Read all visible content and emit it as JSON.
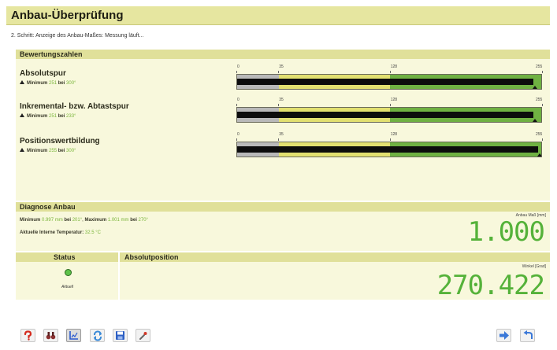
{
  "window": {
    "title": "Anbau-Überprüfung"
  },
  "step": {
    "text": "2. Schritt: Anzeige des Anbau-Maßes: Messung läuft..."
  },
  "ratings": {
    "header": "Bewertungszahlen",
    "scale_ticks": [
      "0",
      "35",
      "128",
      "255"
    ],
    "rows": [
      {
        "name": "Absolutspur",
        "min_label": "Minimum",
        "min_value": "251",
        "at_label": "bei",
        "at_value": "300°",
        "value": 251
      },
      {
        "name": "Inkremental- bzw. Abtastspur",
        "min_label": "Minimum",
        "min_value": "251",
        "at_label": "bei",
        "at_value": "233°",
        "value": 251
      },
      {
        "name": "Positionswertbildung",
        "min_label": "Minimum",
        "min_value": "255",
        "at_label": "bei",
        "at_value": "300°",
        "value": 255
      }
    ]
  },
  "diagnose": {
    "header": "Diagnose Anbau",
    "line1": {
      "min_label": "Minimum",
      "min_value": "0.997 mm",
      "min_at": "bei",
      "min_deg": "201°",
      "sep": ",",
      "max_label": "Maximum",
      "max_value": "1.001 mm",
      "max_at": "bei",
      "max_deg": "270°"
    },
    "line2": {
      "label": "Aktuelle Interne Temperatur:",
      "value": "32.5 °C"
    },
    "anbau_label": "Anbau Maß [mm]",
    "anbau_value": "1.000"
  },
  "status": {
    "header": "Status",
    "indicator_text": "Aktuell",
    "led_color": "#5ec24a"
  },
  "position": {
    "header": "Absolutposition",
    "unit_label": "Winkel [Grad]",
    "value": "270.422"
  },
  "colors": {
    "bar_grey": "#b9b9b9",
    "bar_yellow": "#e2e070",
    "bar_green": "#6fb142",
    "bar_green_dark": "#58a033",
    "lcd_green": "#55b23a"
  },
  "toolbar": {
    "left": [
      {
        "icon": "help-icon"
      },
      {
        "icon": "binoculars-icon"
      },
      {
        "icon": "chart-icon",
        "pressed": true
      },
      {
        "icon": "refresh-icon"
      },
      {
        "icon": "save-icon"
      },
      {
        "icon": "tool-icon"
      }
    ],
    "right": [
      {
        "icon": "arrow-right-icon"
      },
      {
        "icon": "back-icon"
      }
    ]
  }
}
